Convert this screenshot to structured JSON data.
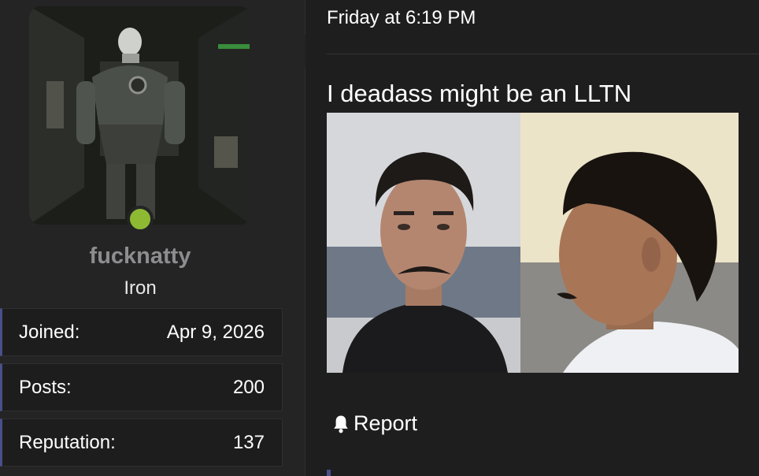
{
  "user": {
    "username": "fucknatty",
    "rank": "Iron",
    "online": true,
    "stats": [
      {
        "label": "Joined:",
        "value": "Apr 9, 2026"
      },
      {
        "label": "Posts:",
        "value": "200"
      },
      {
        "label": "Reputation:",
        "value": "137"
      }
    ]
  },
  "post": {
    "timestamp": "Friday at 6:19 PM",
    "text": "I deadass might be an LLTN",
    "actions": {
      "report_label": "Report",
      "report_icon": "bell-icon"
    }
  },
  "colors": {
    "online": "#8dba32",
    "stat_accent": "#4a4f8a",
    "username": "#8d8d8f"
  }
}
